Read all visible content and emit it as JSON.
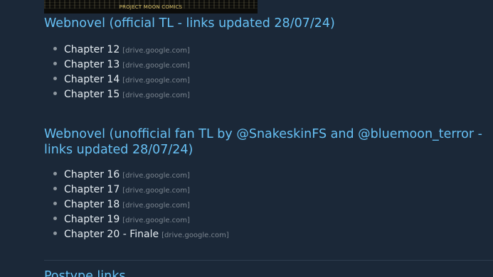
{
  "banner": {
    "text": "PROJECT MOON COMICS"
  },
  "sections": [
    {
      "title": "Webnovel (official TL - links updated 28/07/24)",
      "chapters": [
        {
          "label": "Chapter 12",
          "domain": "[drive.google.com]"
        },
        {
          "label": "Chapter 13",
          "domain": "[drive.google.com]"
        },
        {
          "label": "Chapter 14",
          "domain": "[drive.google.com]"
        },
        {
          "label": "Chapter 15",
          "domain": "[drive.google.com]"
        }
      ]
    },
    {
      "title": "Webnovel (unofficial fan TL by @SnakeskinFS and @bluemoon_terror - links updated 28/07/24)",
      "chapters": [
        {
          "label": "Chapter 16",
          "domain": "[drive.google.com]"
        },
        {
          "label": "Chapter 17",
          "domain": "[drive.google.com]"
        },
        {
          "label": "Chapter 18",
          "domain": "[drive.google.com]"
        },
        {
          "label": "Chapter 19",
          "domain": "[drive.google.com]"
        },
        {
          "label": "Chapter 20 - Finale",
          "domain": "[drive.google.com]"
        }
      ]
    },
    {
      "title": "Postype links"
    }
  ],
  "colors": {
    "background": "#1b2838",
    "heading": "#67c1f5",
    "link": "#e6edf2",
    "domain": "#7c8690"
  }
}
